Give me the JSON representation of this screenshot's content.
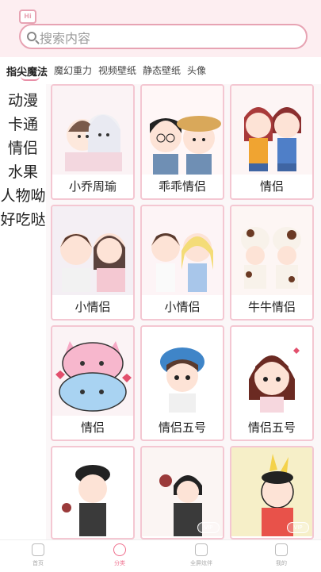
{
  "header": {
    "badge": "Hi",
    "search_placeholder": "搜索内容"
  },
  "tabs": [
    {
      "label": "指尖魔法",
      "active": true
    },
    {
      "label": "魔幻重力"
    },
    {
      "label": "视频壁纸"
    },
    {
      "label": "静态壁纸"
    },
    {
      "label": "头像"
    }
  ],
  "sidebar": [
    {
      "label": "动漫"
    },
    {
      "label": "卡通"
    },
    {
      "label": "情侣",
      "active": true
    },
    {
      "label": "水果"
    },
    {
      "label": "人物呦"
    },
    {
      "label": "好吃哒"
    }
  ],
  "cards": [
    {
      "label": "小乔周瑜"
    },
    {
      "label": "乖乖情侣"
    },
    {
      "label": "情侣"
    },
    {
      "label": "小情侣"
    },
    {
      "label": "小情侣"
    },
    {
      "label": "牛牛情侣"
    },
    {
      "label": "情侣"
    },
    {
      "label": "情侣五号"
    },
    {
      "label": "情侣五号"
    },
    {
      "label": ""
    },
    {
      "label": ""
    },
    {
      "label": ""
    }
  ],
  "vip_badge": "VIP",
  "bottom_nav": [
    {
      "label": "首页",
      "icon": "home-icon"
    },
    {
      "label": "分类",
      "icon": "category-icon",
      "active": true
    },
    {
      "label": "全屏炫伴",
      "icon": "fullscreen-icon"
    },
    {
      "label": "我的",
      "icon": "profile-icon"
    }
  ],
  "colors": {
    "accent": "#ef6e8c",
    "border_pink": "#f4c7d2",
    "header_bg": "#fdeef1"
  }
}
